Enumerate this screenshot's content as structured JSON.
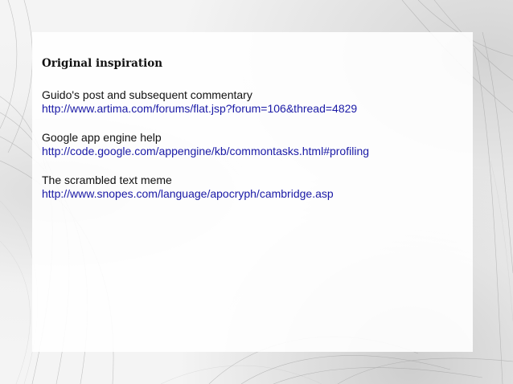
{
  "heading": "Original inspiration",
  "entries": [
    {
      "title": "Guido's post and subsequent commentary",
      "url": "http://www.artima.com/forums/flat.jsp?forum=106&thread=4829"
    },
    {
      "title": "Google app engine help",
      "url": "http://code.google.com/appengine/kb/commontasks.html#profiling"
    },
    {
      "title": "The scrambled text meme",
      "url": "http://www.snopes.com/language/apocryph/cambridge.asp"
    }
  ],
  "colors": {
    "link": "#1a1aa6",
    "text": "#111111",
    "background": "#f4f4f4"
  }
}
